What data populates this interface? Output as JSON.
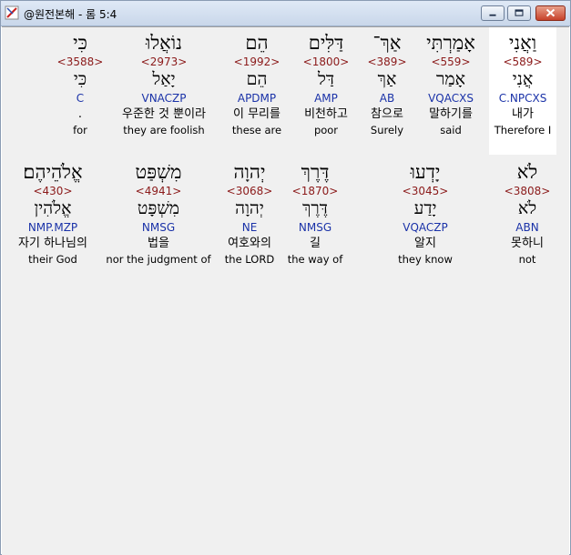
{
  "window": {
    "title": "@원전본해 - 롬 5:4"
  },
  "rows": [
    [
      {
        "heb": "וַאֲנִי",
        "strong": "<589>",
        "lemma": "אֲנִי",
        "morph": "C.NPCXS",
        "kor": "내가",
        "eng": "Therefore I",
        "highlight": true
      },
      {
        "heb": "אָמַרְתִּי",
        "strong": "<559>",
        "lemma": "אָמַר",
        "morph": "VQACXS",
        "kor": "말하기를",
        "eng": "said"
      },
      {
        "heb": "אַךְ־",
        "strong": "<389>",
        "lemma": "אַךְ",
        "morph": "AB",
        "kor": "참으로",
        "eng": "Surely"
      },
      {
        "heb": "דַּלִּים",
        "strong": "<1800>",
        "lemma": "דַּל",
        "morph": "AMP",
        "kor": "비천하고",
        "eng": "poor"
      },
      {
        "heb": "הֵם",
        "strong": "<1992>",
        "lemma": "הֵם",
        "morph": "APDMP",
        "kor": "이 무리를",
        "eng": "these are"
      },
      {
        "heb": "נוֹאֲלוּ",
        "strong": "<2973>",
        "lemma": "יָאַל",
        "morph": "VNACZP",
        "kor": "우준한 것 뿐이라",
        "eng": "they are foolish"
      },
      {
        "heb": "כִּי",
        "strong": "<3588>",
        "lemma": "כִּי",
        "morph": "C",
        "kor": ".",
        "eng": "for"
      }
    ],
    [
      {
        "heb": "לֹא",
        "strong": "<3808>",
        "lemma": "לֹא",
        "morph": "ABN",
        "kor": "못하니",
        "eng": "not"
      },
      {
        "heb": "יָדְעוּ",
        "strong": "<3045>",
        "lemma": "יָדַע",
        "morph": "VQACZP",
        "kor": "알지",
        "eng": "they know"
      },
      {
        "heb": "דֶּרֶךְ",
        "strong": "<1870>",
        "lemma": "דֶּרֶךְ",
        "morph": "NMSG",
        "kor": "길",
        "eng": "the way of"
      },
      {
        "heb": "יְהוָה",
        "strong": "<3068>",
        "lemma": "יְהוָה",
        "morph": "NE",
        "kor": "여호와의",
        "eng": "the LORD"
      },
      {
        "heb": "מִשְׁפַּט",
        "strong": "<4941>",
        "lemma": "מִשְׁפָּט",
        "morph": "NMSG",
        "kor": "법을",
        "eng": "nor the judgment of"
      },
      {
        "heb": "אֱלֹהֵיהֶם׃",
        "strong": "<430>",
        "lemma": "אֱלֹהִין",
        "morph": "NMP.MZP",
        "kor": "자기 하나님의",
        "eng": "their God"
      }
    ]
  ],
  "colors": {
    "strong": "#8b1a1a",
    "morph": "#1a32a8",
    "highlight": "#ffffff",
    "background": "#f0f0f0"
  },
  "icons": {
    "app": "app-icon",
    "minimize": "minimize-icon",
    "maximize": "maximize-icon",
    "close": "close-icon"
  }
}
